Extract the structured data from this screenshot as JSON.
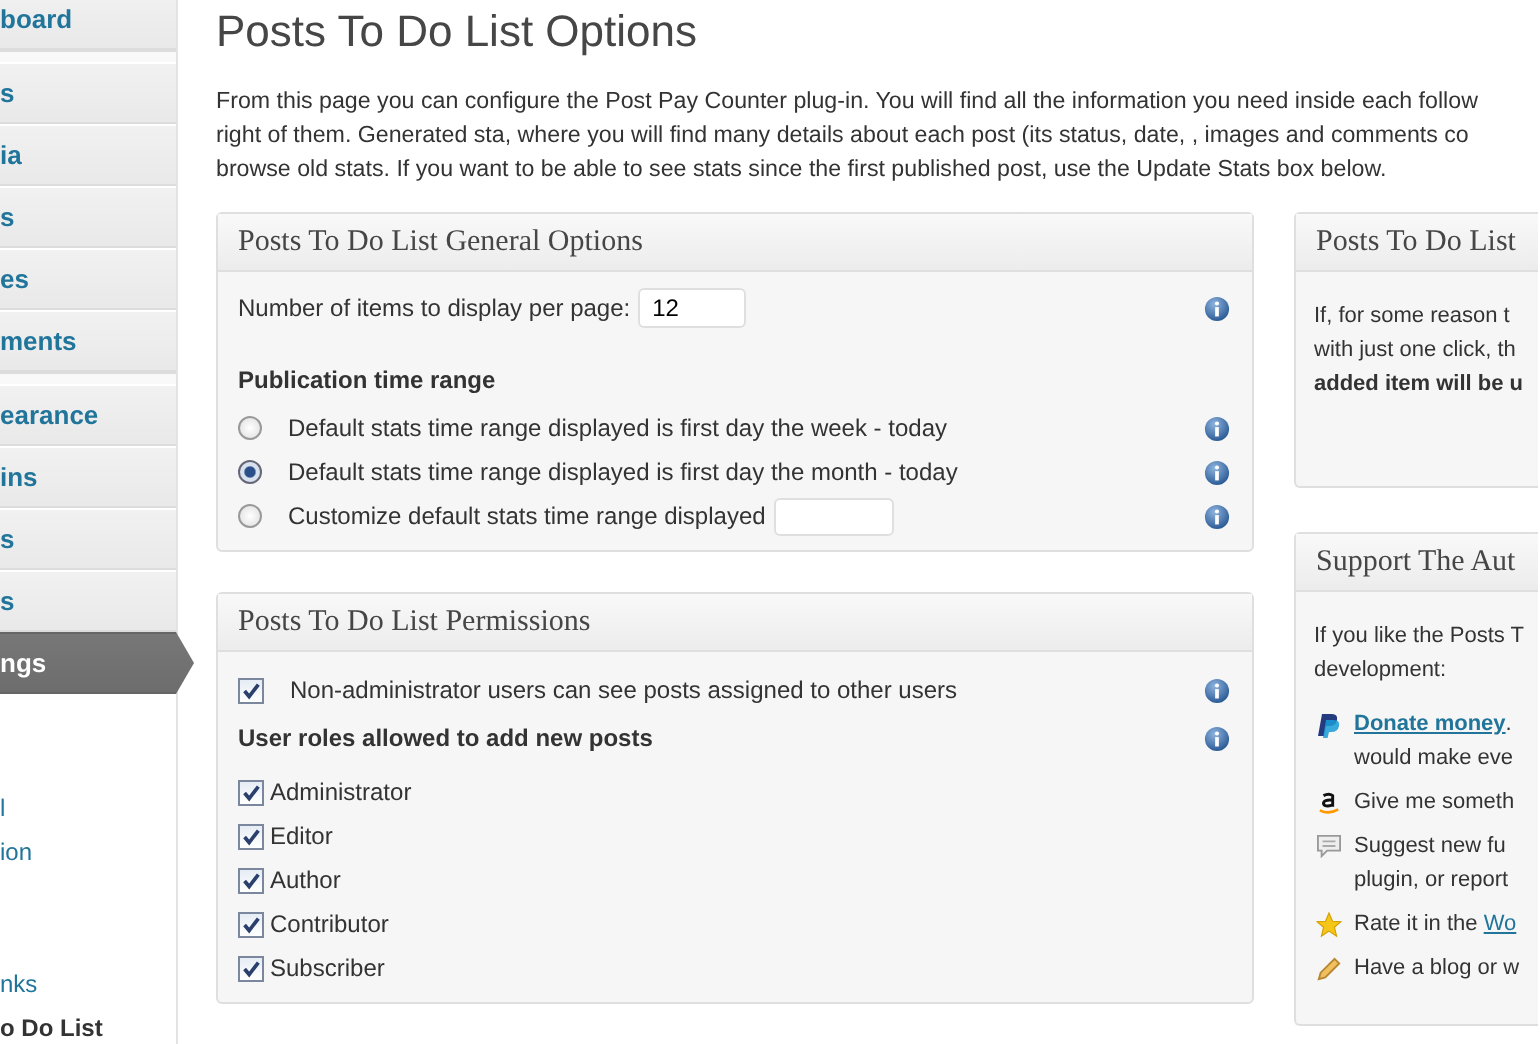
{
  "sidebar": {
    "items": [
      {
        "label": "board",
        "selected": false
      },
      {
        "label": "s",
        "selected": false
      },
      {
        "label": "ia",
        "selected": false
      },
      {
        "label": "s",
        "selected": false
      },
      {
        "label": "es",
        "selected": false
      },
      {
        "label": "ments",
        "selected": false
      },
      {
        "label": "earance",
        "selected": false
      },
      {
        "label": "ins",
        "selected": false
      },
      {
        "label": "s",
        "selected": false
      },
      {
        "label": "s",
        "selected": false
      },
      {
        "label": "ngs",
        "selected": true
      }
    ],
    "submenu": [
      {
        "label": "l",
        "selected": false
      },
      {
        "label": "ion",
        "selected": false
      },
      {
        "label": "nks",
        "selected": false
      },
      {
        "label": "o Do List",
        "selected": true
      }
    ]
  },
  "page": {
    "title": "Posts To Do List Options",
    "intro": [
      "From this page you can configure the Post Pay Counter plug-in. You will find all the information you need inside each follow",
      "right of them. Generated sta, where you will find many details about each post (its status, date, , images and comments co",
      "browse old stats. If you want to be able to see stats since the first published post, use the Update Stats box below."
    ]
  },
  "general_options": {
    "title": "Posts To Do List General Options",
    "items_per_page": {
      "label": "Number of items to display per page:",
      "value": "12"
    },
    "time_range": {
      "heading": "Publication time range",
      "options": [
        {
          "label": "Default stats time range displayed is first day the week - today",
          "selected": false
        },
        {
          "label": "Default stats time range displayed is first day the month - today",
          "selected": true
        },
        {
          "label": "Customize default stats time range displayed",
          "selected": false,
          "has_field": true
        }
      ]
    }
  },
  "permissions": {
    "title": "Posts To Do List Permissions",
    "see_others": {
      "label": "Non-administrator users can see posts assigned to other users",
      "checked": true
    },
    "roles_heading": "User roles allowed to add new posts",
    "roles": [
      {
        "label": "Administrator",
        "checked": true
      },
      {
        "label": "Editor",
        "checked": true
      },
      {
        "label": "Author",
        "checked": true
      },
      {
        "label": "Contributor",
        "checked": true
      },
      {
        "label": "Subscriber",
        "checked": true
      }
    ]
  },
  "side_box": {
    "title": "Posts To Do List",
    "lines": [
      "If, for some reason t",
      "with just one click, th"
    ],
    "bold_line": "added item will be u"
  },
  "support_box": {
    "title": "Support The Aut",
    "intro": [
      "If you like the Posts T",
      "development:"
    ],
    "items": [
      {
        "kind": "paypal",
        "link": "Donate money",
        "text": ".",
        "lines": [
          "would make eve"
        ]
      },
      {
        "kind": "amazon",
        "text": "Give me someth"
      },
      {
        "kind": "comment",
        "text": "Suggest new fu",
        "lines": [
          "plugin, or report"
        ]
      },
      {
        "kind": "star",
        "text": "Rate it in the ",
        "link": "Wo"
      },
      {
        "kind": "pencil",
        "text": "Have a blog or w"
      }
    ]
  }
}
